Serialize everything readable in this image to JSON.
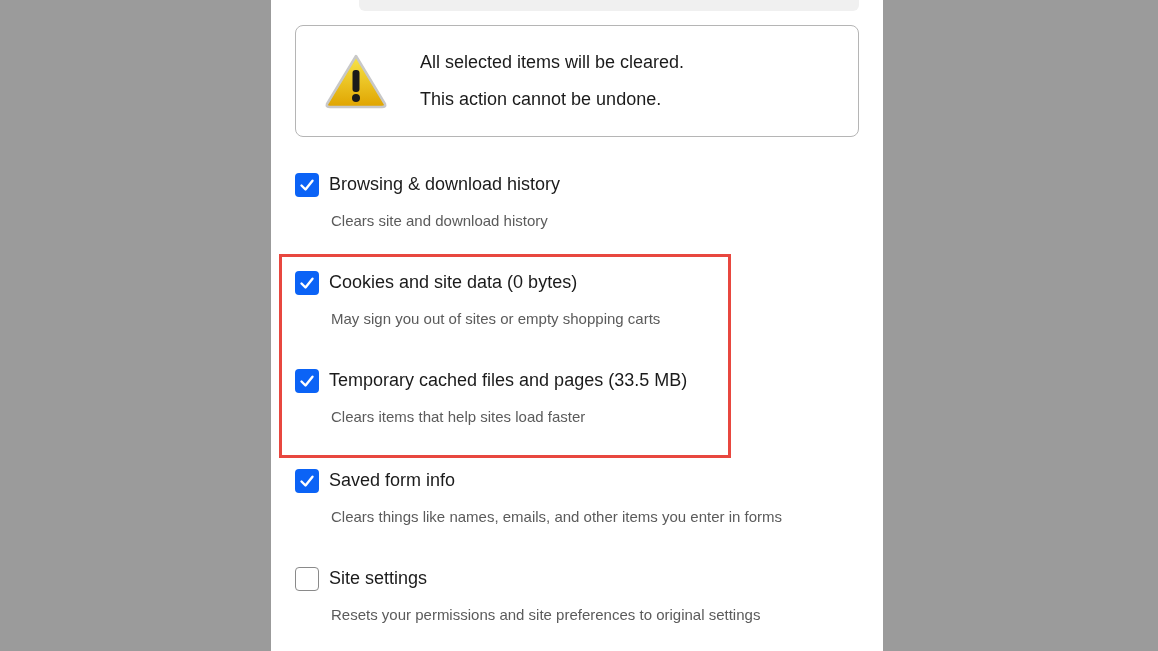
{
  "warning": {
    "lines": [
      "All selected items will be cleared.",
      "This action cannot be undone."
    ]
  },
  "options": [
    {
      "label": "Browsing & download history",
      "description": "Clears site and download history",
      "checked": true,
      "highlighted": false
    },
    {
      "label": "Cookies and site data (0 bytes)",
      "description": "May sign you out of sites or empty shopping carts",
      "checked": true,
      "highlighted": true
    },
    {
      "label": "Temporary cached files and pages (33.5 MB)",
      "description": "Clears items that help sites load faster",
      "checked": true,
      "highlighted": true
    },
    {
      "label": "Saved form info",
      "description": "Clears things like names, emails, and other items you enter in forms",
      "checked": true,
      "highlighted": false
    },
    {
      "label": "Site settings",
      "description": "Resets your permissions and site preferences to original settings",
      "checked": false,
      "highlighted": false
    }
  ]
}
